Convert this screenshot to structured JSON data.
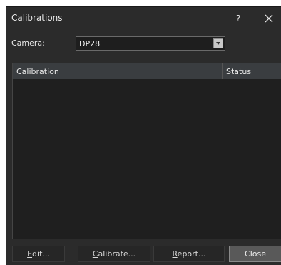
{
  "window": {
    "title": "Calibrations",
    "help_label": "?",
    "close_icon": "close-icon"
  },
  "camera": {
    "label": "Camera:",
    "selected": "DP28"
  },
  "table": {
    "columns": [
      "Calibration",
      "Status"
    ],
    "rows": []
  },
  "buttons": {
    "edit": {
      "accel": "E",
      "rest": "dit..."
    },
    "calibrate": {
      "accel": "C",
      "rest": "alibrate..."
    },
    "report": {
      "accel": "R",
      "rest": "eport..."
    },
    "close": "Close"
  },
  "colors": {
    "background": "#2b2b2b",
    "table_bg": "#1f1f1f",
    "header_bg": "#3a3d40",
    "close_button_bg": "#595959"
  }
}
